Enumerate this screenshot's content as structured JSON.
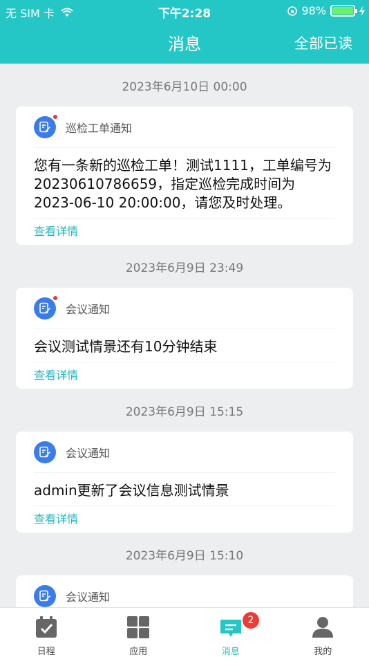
{
  "status_bar": {
    "carrier": "无 SIM 卡",
    "time": "下午2:28",
    "battery_pct": "98%"
  },
  "nav": {
    "title": "消息",
    "mark_all_read": "全部已读"
  },
  "messages": [
    {
      "date": "2023年6月10日 00:00",
      "type": "巡检工单通知",
      "unread": true,
      "body": "您有一条新的巡检工单！测试1111，工单编号为20230610786659，指定巡检完成时间为2023-06-10 20:00:00，请您及时处理。",
      "link": "查看详情"
    },
    {
      "date": "2023年6月9日 23:49",
      "type": "会议通知",
      "unread": true,
      "body": "会议测试情景还有10分钟结束",
      "link": "查看详情"
    },
    {
      "date": "2023年6月9日 15:15",
      "type": "会议通知",
      "unread": false,
      "body": "admin更新了会议信息测试情景",
      "link": "查看详情"
    },
    {
      "date": "2023年6月9日 15:10",
      "type": "会议通知",
      "unread": false,
      "body": "",
      "link": ""
    }
  ],
  "tabbar": {
    "tabs": [
      {
        "label": "日程",
        "icon": "calendar-check-icon"
      },
      {
        "label": "应用",
        "icon": "grid-icon"
      },
      {
        "label": "消息",
        "icon": "message-icon",
        "badge": "2",
        "active": true
      },
      {
        "label": "我的",
        "icon": "person-icon"
      }
    ]
  },
  "colors": {
    "accent": "#24c6c6",
    "link": "#24b8c2",
    "badge": "#f03b35",
    "avatar": "#3a7ce8"
  }
}
